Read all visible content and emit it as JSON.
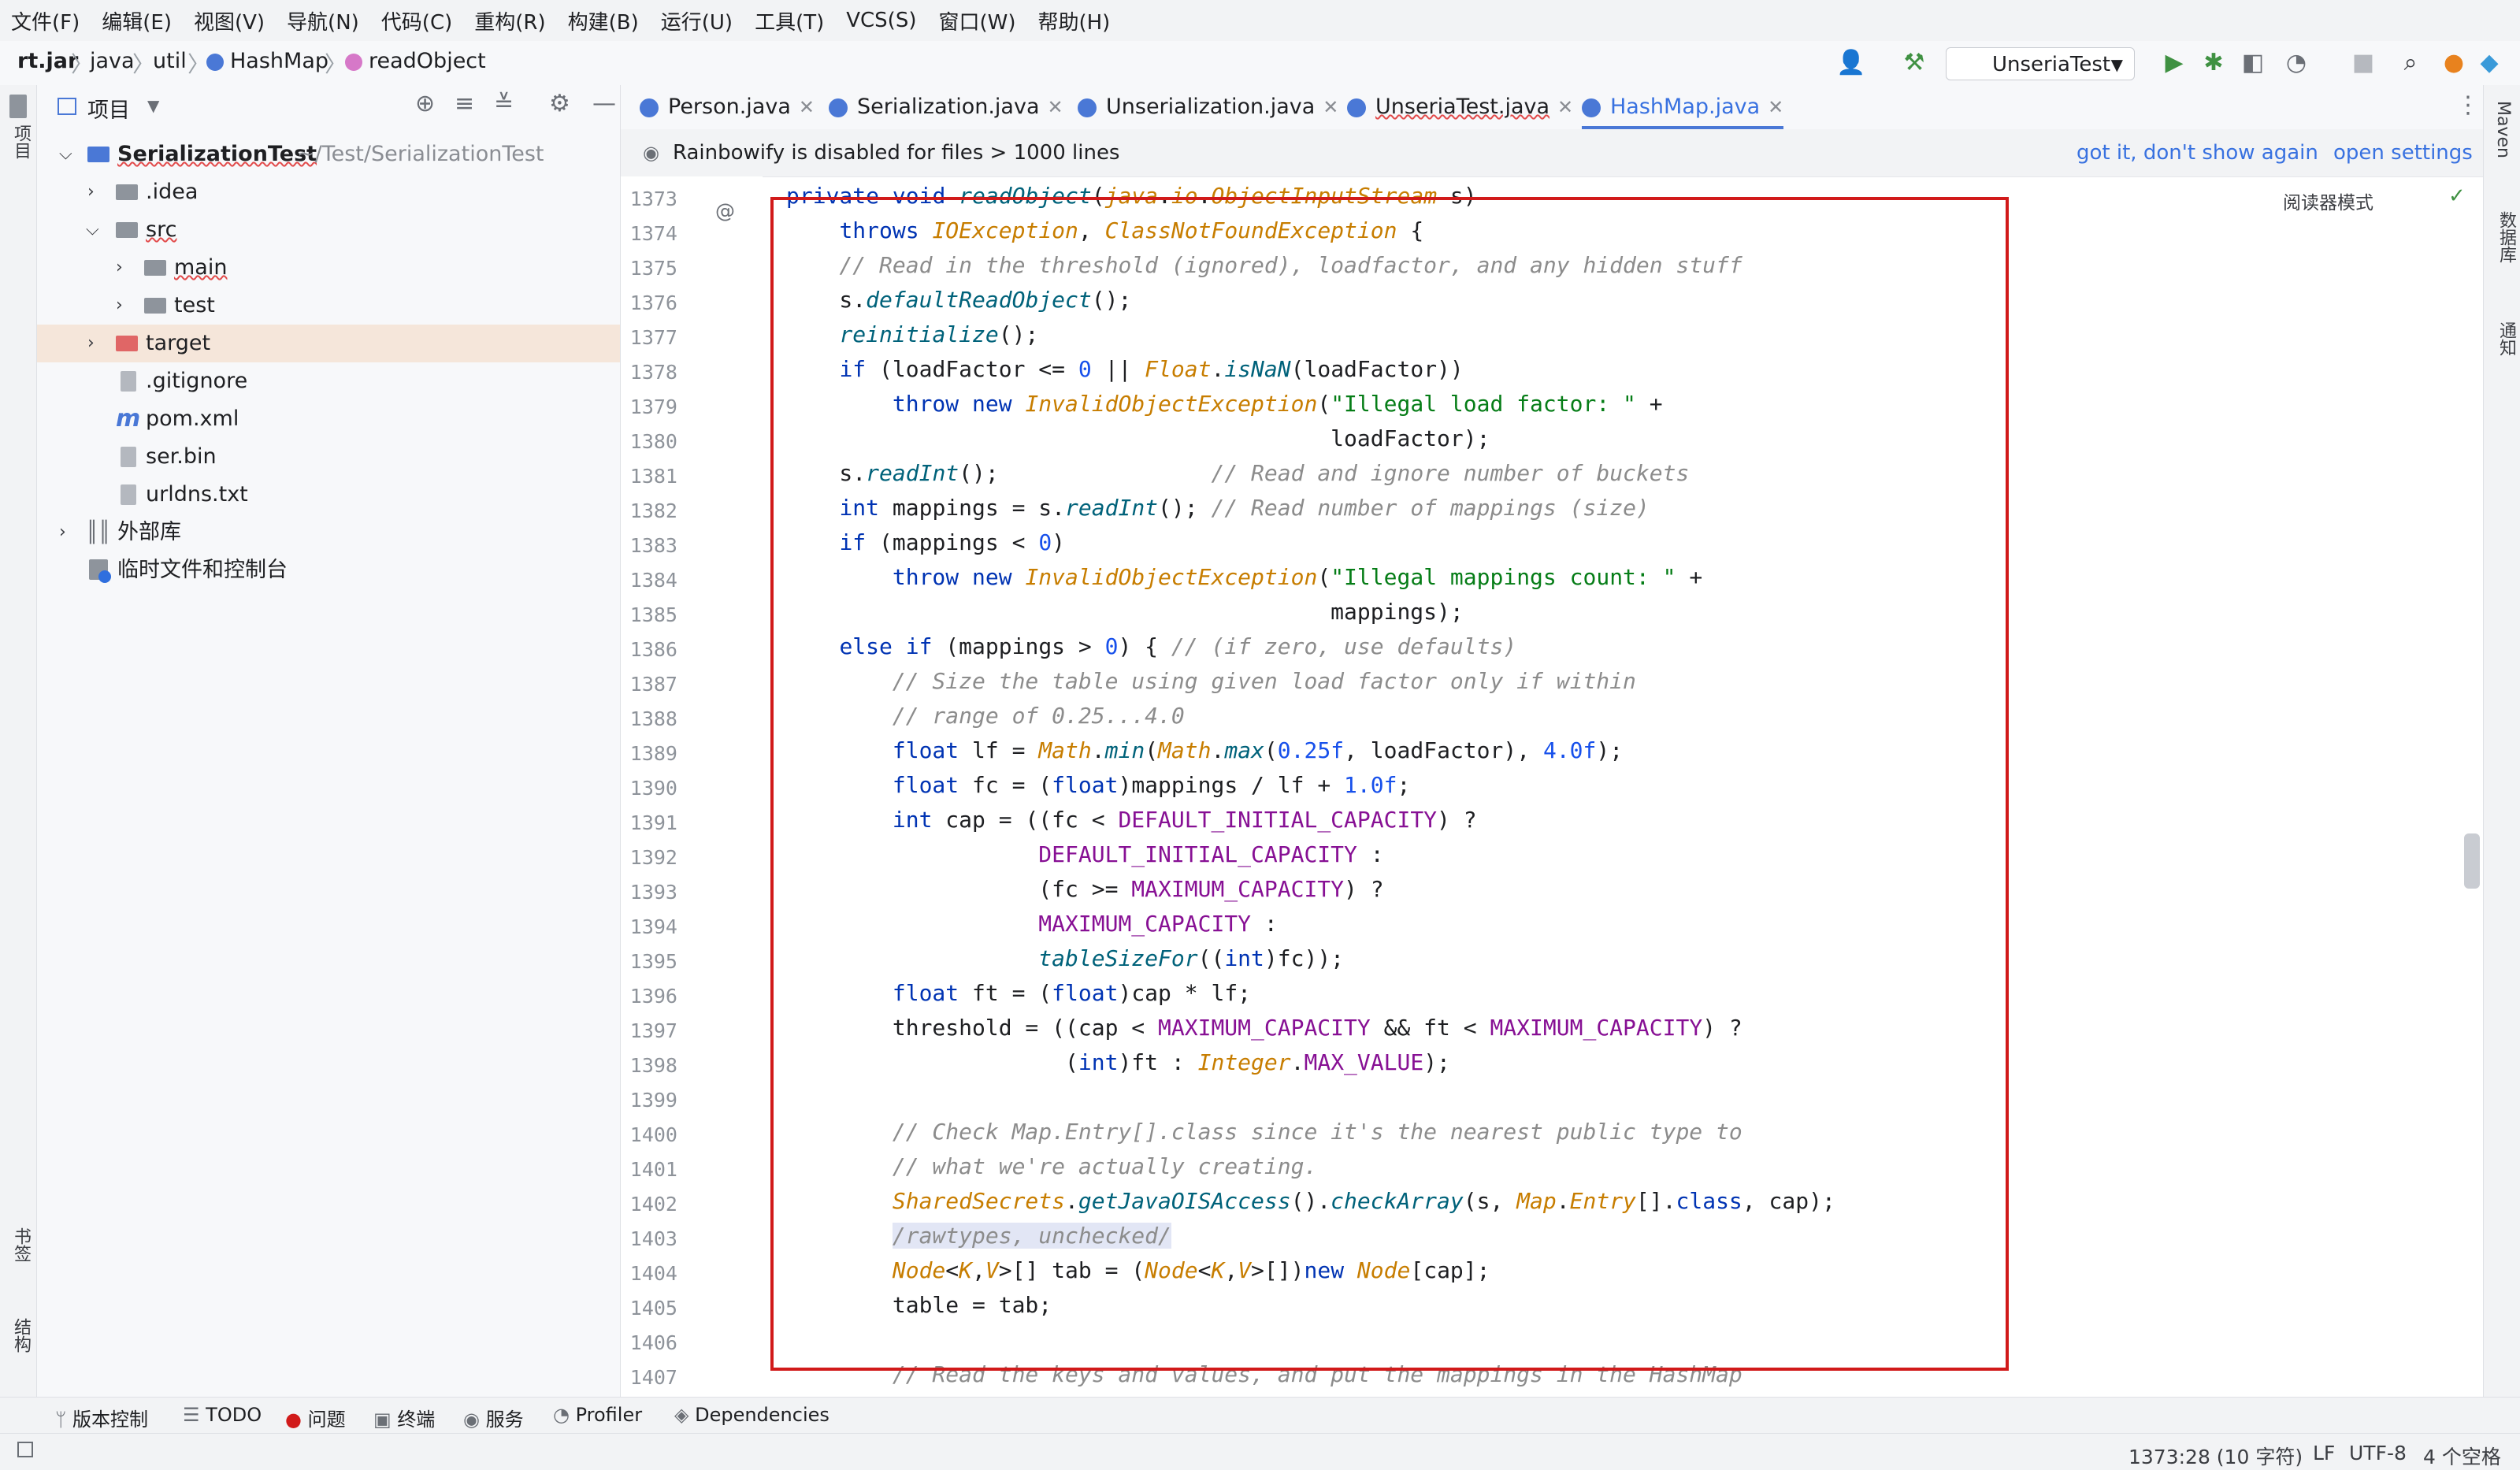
{
  "menu": [
    "文件(F)",
    "编辑(E)",
    "视图(V)",
    "导航(N)",
    "代码(C)",
    "重构(R)",
    "构建(B)",
    "运行(U)",
    "工具(T)",
    "VCS(S)",
    "窗口(W)",
    "帮助(H)"
  ],
  "breadcrumb": [
    "rt.jar",
    "java",
    "util",
    "HashMap",
    "readObject"
  ],
  "run_config": "UnseriaTest",
  "project": {
    "title": "项目",
    "tree": [
      {
        "label": "SerializationTest",
        "path": "~/Test/SerializationTest"
      },
      {
        "label": ".idea"
      },
      {
        "label": "src"
      },
      {
        "label": "main"
      },
      {
        "label": "test"
      },
      {
        "label": "target"
      },
      {
        "label": ".gitignore"
      },
      {
        "label": "pom.xml"
      },
      {
        "label": "ser.bin"
      },
      {
        "label": "urldns.txt"
      },
      {
        "label": "外部库"
      },
      {
        "label": "临时文件和控制台"
      }
    ]
  },
  "left_stripe": [
    "项目",
    "书签",
    "结构"
  ],
  "right_stripe": [
    "Maven",
    "数据库",
    "通知"
  ],
  "tabs": [
    "Person.java",
    "Serialization.java",
    "Unserialization.java",
    "UnseriaTest.java",
    "HashMap.java"
  ],
  "banner": {
    "text": "Rainbowify is disabled for files > 1000 lines",
    "link1": "got it, don't show again",
    "link2": "open settings"
  },
  "reader_mode": "阅读器模式",
  "line_numbers": [
    "1373",
    "1374",
    "1375",
    "1376",
    "1377",
    "1378",
    "1379",
    "1380",
    "1381",
    "1382",
    "1383",
    "1384",
    "1385",
    "1386",
    "1387",
    "1388",
    "1389",
    "1390",
    "1391",
    "1392",
    "1393",
    "1394",
    "1395",
    "1396",
    "1397",
    "1398",
    "1399",
    "1400",
    "1401",
    "1402",
    "1403",
    "1404",
    "1405",
    "1406",
    "1407"
  ],
  "code_lines": [
    "private void readObject(java.io.ObjectInputStream s)",
    "    throws IOException, ClassNotFoundException {",
    "    // Read in the threshold (ignored), loadfactor, and any hidden stuff",
    "    s.defaultReadObject();",
    "    reinitialize();",
    "    if (loadFactor <= 0 || Float.isNaN(loadFactor))",
    "        throw new InvalidObjectException(\"Illegal load factor: \" +",
    "                                         loadFactor);",
    "    s.readInt();                // Read and ignore number of buckets",
    "    int mappings = s.readInt(); // Read number of mappings (size)",
    "    if (mappings < 0)",
    "        throw new InvalidObjectException(\"Illegal mappings count: \" +",
    "                                         mappings);",
    "    else if (mappings > 0) { // (if zero, use defaults)",
    "        // Size the table using given load factor only if within",
    "        // range of 0.25...4.0",
    "        float lf = Math.min(Math.max(0.25f, loadFactor), 4.0f);",
    "        float fc = (float)mappings / lf + 1.0f;",
    "        int cap = ((fc < DEFAULT_INITIAL_CAPACITY) ?",
    "                   DEFAULT_INITIAL_CAPACITY :",
    "                   (fc >= MAXIMUM_CAPACITY) ?",
    "                   MAXIMUM_CAPACITY :",
    "                   tableSizeFor((int)fc));",
    "        float ft = (float)cap * lf;",
    "        threshold = ((cap < MAXIMUM_CAPACITY && ft < MAXIMUM_CAPACITY) ?",
    "                     (int)ft : Integer.MAX_VALUE);",
    "",
    "        // Check Map.Entry[].class since it's the nearest public type to",
    "        // what we're actually creating.",
    "        SharedSecrets.getJavaOISAccess().checkArray(s, Map.Entry[].class, cap);",
    "        /rawtypes, unchecked/",
    "        Node<K,V>[] tab = (Node<K,V>[])new Node[cap];",
    "        table = tab;",
    "",
    "        // Read the keys and values, and put the mappings in the HashMap"
  ],
  "tool_windows": [
    "版本控制",
    "TODO",
    "问题",
    "终端",
    "服务",
    "Profiler",
    "Dependencies"
  ],
  "status": {
    "position": "1373:28 (10 字符)",
    "line_sep": "LF",
    "encoding": "UTF-8",
    "indent": "4 个空格"
  }
}
